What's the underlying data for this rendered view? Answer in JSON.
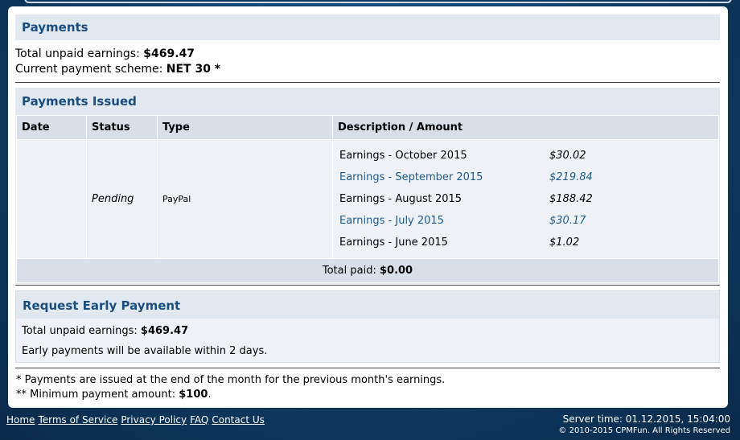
{
  "payments": {
    "title": "Payments",
    "unpaid_label": "Total unpaid earnings:",
    "unpaid_value": "$469.47",
    "scheme_label": "Current payment scheme:",
    "scheme_value": "NET 30 *"
  },
  "issued": {
    "title": "Payments Issued",
    "columns": [
      "Date",
      "Status",
      "Type",
      "Description / Amount"
    ],
    "row": {
      "date": "",
      "status": "Pending",
      "type": "PayPal",
      "items": [
        {
          "name": "Earnings - October 2015",
          "amount": "$30.02"
        },
        {
          "name": "Earnings - September 2015",
          "amount": "$219.84"
        },
        {
          "name": "Earnings - August 2015",
          "amount": "$188.42"
        },
        {
          "name": "Earnings - July 2015",
          "amount": "$30.17"
        },
        {
          "name": "Earnings - June 2015",
          "amount": "$1.02"
        }
      ]
    },
    "total_label": "Total paid:",
    "total_value": "$0.00"
  },
  "early": {
    "title": "Request Early Payment",
    "unpaid_label": "Total unpaid earnings:",
    "unpaid_value": "$469.47",
    "note": "Early payments will be available within 2 days."
  },
  "notes": {
    "n1": "* Payments are issued at the end of the month for the previous month's earnings.",
    "n2_label": "** Minimum payment amount:",
    "n2_value": "$100",
    "n2_end": "."
  },
  "footer": {
    "links": [
      "Home",
      "Terms of Service",
      "Privacy Policy",
      "FAQ",
      "Contact Us"
    ],
    "server_time": "Server time: 01.12.2015, 15:04:00",
    "copyright": "© 2010-2015 CPMFun. All Rights Reserved"
  }
}
